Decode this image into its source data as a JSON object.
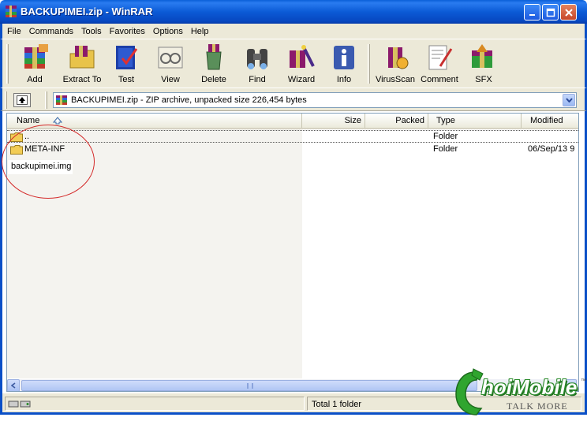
{
  "window": {
    "title": "BACKUPIMEI.zip - WinRAR"
  },
  "menu": [
    "File",
    "Commands",
    "Tools",
    "Favorites",
    "Options",
    "Help"
  ],
  "toolbar": {
    "buttons": [
      "Add",
      "Extract To",
      "Test",
      "View",
      "Delete",
      "Find",
      "Wizard",
      "Info",
      "VirusScan",
      "Comment",
      "SFX"
    ]
  },
  "address": {
    "text": "BACKUPIMEI.zip - ZIP archive, unpacked size 226,454 bytes"
  },
  "columns": [
    "Name",
    "Size",
    "Packed",
    "Type",
    "Modified"
  ],
  "rows": [
    {
      "name": "..",
      "size": "",
      "packed": "",
      "type": "Folder",
      "modified": ""
    },
    {
      "name": "META-INF",
      "size": "",
      "packed": "",
      "type": "Folder",
      "modified": "06/Sep/13 9"
    }
  ],
  "annotation": {
    "label": "backupimei.img",
    "color": "#d42a2a"
  },
  "status": {
    "text": "Total 1 folder"
  },
  "watermark": {
    "brand": "hoiMobile",
    "tagline": "TALK MORE",
    "tm": "™"
  },
  "colors": {
    "titlebar": "#0a5fd8",
    "chrome": "#ece9d8",
    "border": "#0a4fc7"
  }
}
